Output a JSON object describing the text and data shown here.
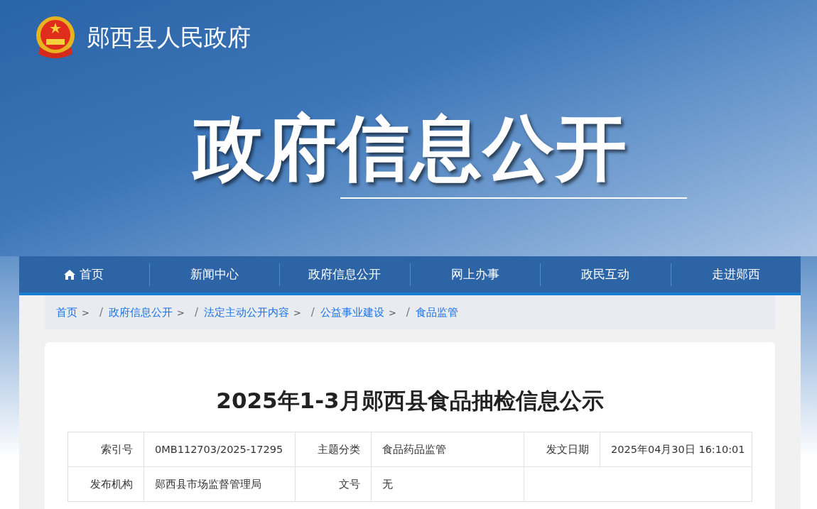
{
  "site": {
    "name": "郧西县人民政府"
  },
  "banner": {
    "title": "政府信息公开"
  },
  "nav": [
    {
      "label": "首页",
      "kind": "home"
    },
    {
      "label": "新闻中心",
      "kind": "plain"
    },
    {
      "label": "政府信息公开",
      "kind": "plain"
    },
    {
      "label": "网上办事",
      "kind": "plain"
    },
    {
      "label": "政民互动",
      "kind": "plain"
    },
    {
      "label": "走进郧西",
      "kind": "plain"
    }
  ],
  "breadcrumb": [
    {
      "label": "首页",
      "arrow": ">"
    },
    {
      "separator": "/",
      "label": "政府信息公开",
      "arrow": ">"
    },
    {
      "separator": "/",
      "label": "法定主动公开内容",
      "arrow": ">"
    },
    {
      "separator": "/",
      "label": "公益事业建设",
      "arrow": ">"
    },
    {
      "separator": "/",
      "label": "食品监管"
    }
  ],
  "article": {
    "title": "2025年1-3月郧西县食品抽检信息公示",
    "meta": [
      [
        {
          "label": "索引号",
          "value": "0MB112703/2025-17295"
        },
        {
          "label": "主题分类",
          "value": "食品药品监管"
        },
        {
          "label": "发文日期",
          "value": "2025年04月30日 16:10:01"
        }
      ],
      [
        {
          "label": "发布机构",
          "value": "郧西县市场监督管理局"
        },
        {
          "label": "文号",
          "value": "无"
        }
      ]
    ]
  }
}
